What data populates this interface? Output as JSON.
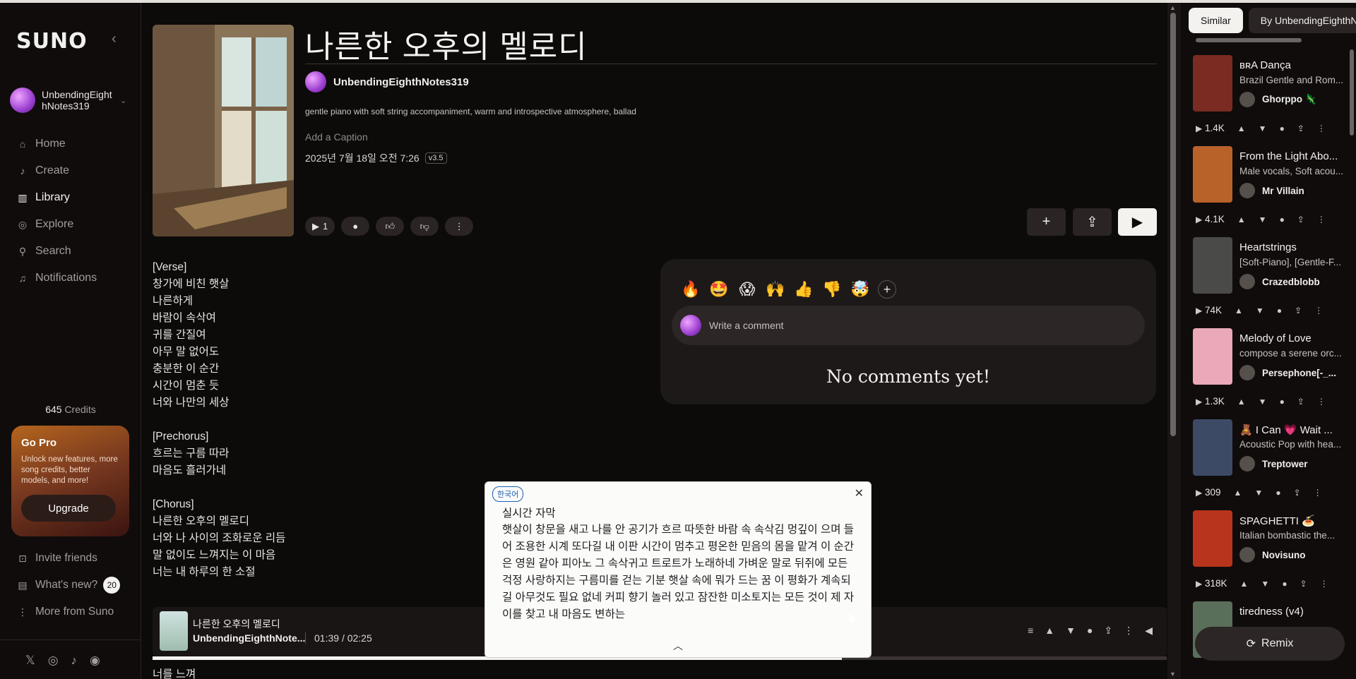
{
  "app": {
    "logo": "SUNO"
  },
  "user": {
    "name": "UnbendingEighthNotes319"
  },
  "nav": [
    {
      "label": "Home",
      "icon": "home-icon",
      "glyph": "⌂"
    },
    {
      "label": "Create",
      "icon": "create-icon",
      "glyph": "♪"
    },
    {
      "label": "Library",
      "icon": "library-icon",
      "glyph": "▥"
    },
    {
      "label": "Explore",
      "icon": "explore-icon",
      "glyph": "◎"
    },
    {
      "label": "Search",
      "icon": "search-icon",
      "glyph": "⚲"
    },
    {
      "label": "Notifications",
      "icon": "bell-icon",
      "glyph": "🔔"
    }
  ],
  "credits": {
    "value": "645",
    "label": "Credits"
  },
  "gopro": {
    "title": "Go Pro",
    "text": "Unlock new features, more song credits, better models, and more!",
    "button": "Upgrade"
  },
  "side_links": {
    "invite": "Invite friends",
    "whats_new": "What's new?",
    "whats_new_count": "20",
    "more": "More from Suno"
  },
  "song": {
    "title": "나른한 오후의 멜로디",
    "author": "UnbendingEighthNotes319",
    "description": "gentle piano with soft string accompaniment, warm and introspective atmosphere, ballad",
    "caption_placeholder": "Add a Caption",
    "date": "2025년 7월 18일 오전 7:26",
    "version": "v3.5",
    "play_count": "1"
  },
  "lyrics": "[Verse]\n창가에 비친 햇살\n나른하게\n바람이 속삭여\n귀를 간질여\n아무 말 없어도\n충분한 이 순간\n시간이 멈춘 듯\n너와 나만의 세상\n\n[Prechorus]\n흐르는 구름 따라\n마음도 흘러가네\n\n[Chorus]\n나른한 오후의 멜로디\n너와 나 사이의 조화로운 리듬\n말 없이도 느껴지는 이 마음\n너는 내 하루의 한 소절",
  "lyrics_tail": "너를 느껴",
  "comments": {
    "reactions": [
      "🔥",
      "🤩",
      "😱",
      "🙌",
      "👍",
      "👎",
      "🤯"
    ],
    "placeholder": "Write a comment",
    "empty": "No comments yet!"
  },
  "player": {
    "title": "나른한 오후의 멜로디",
    "artist": "UnbendingEighthNote...",
    "current": "01:39",
    "separator": "/",
    "duration": "02:25",
    "progress": 0.68
  },
  "subtitles": {
    "lang": "한국어",
    "heading": "실시간 자막",
    "body": "햇살이 창문을 새고 나를 안 공기가 흐르 따뜻한 바람 속 속삭김 멍깊이 으며 들어 조용한 시계 또다길 내 이판 시간이 멈추고 평온한 믿음의 몸을 맡겨 이 순간은 영원 같아 피아노 그 속삭귀고 트로트가 노래하네 가벼운 말로 뒤쥐에 모든 걱정 사랑하지는 구름미를 걷는 기분 햇살 속에 뭐가 드는 꿈 이 평화가 계속되길 아무것도 필요 없네 커피 향기 놀러 있고 잠잔한 미소토지는 모든 것이 제 자이를 찾고 내 마음도 변하는"
  },
  "right_panel": {
    "tabs": [
      "Similar",
      "By UnbendingEighthN"
    ],
    "items": [
      {
        "title": "ʙʀA Dança",
        "subtitle": "Brazil Gentle and Rom...",
        "author": "Ghorppo 🦎",
        "plays": "1.4K",
        "thumb": "#7a2b22"
      },
      {
        "title": "From the Light Abo...",
        "subtitle": "Male vocals, Soft acou...",
        "author": "Mr Villain",
        "plays": "4.1K",
        "thumb": "#b8622a"
      },
      {
        "title": "Heartstrings",
        "subtitle": "[Soft-Piano], [Gentle-F...",
        "author": "Crazedblobb",
        "plays": "74K",
        "thumb": "#4a4a48"
      },
      {
        "title": "Melody of Love",
        "subtitle": "compose a serene orc...",
        "author": "Persephone[-_...",
        "plays": "1.3K",
        "thumb": "#e9a9b8"
      },
      {
        "title": "🧸 I Can 💗 Wait ...",
        "subtitle": "Acoustic Pop with hea...",
        "author": "Treptower",
        "plays": "309",
        "thumb": "#3d4a66"
      },
      {
        "title": "SPAGHETTI 🍝",
        "subtitle": "Italian bombastic the...",
        "author": "Novisuno",
        "plays": "318K",
        "thumb": "#b8341c"
      },
      {
        "title": "tiredness (v4)",
        "subtitle": "",
        "author": "",
        "plays": "",
        "thumb": "#5a6f5a"
      }
    ],
    "remix": "Remix"
  }
}
